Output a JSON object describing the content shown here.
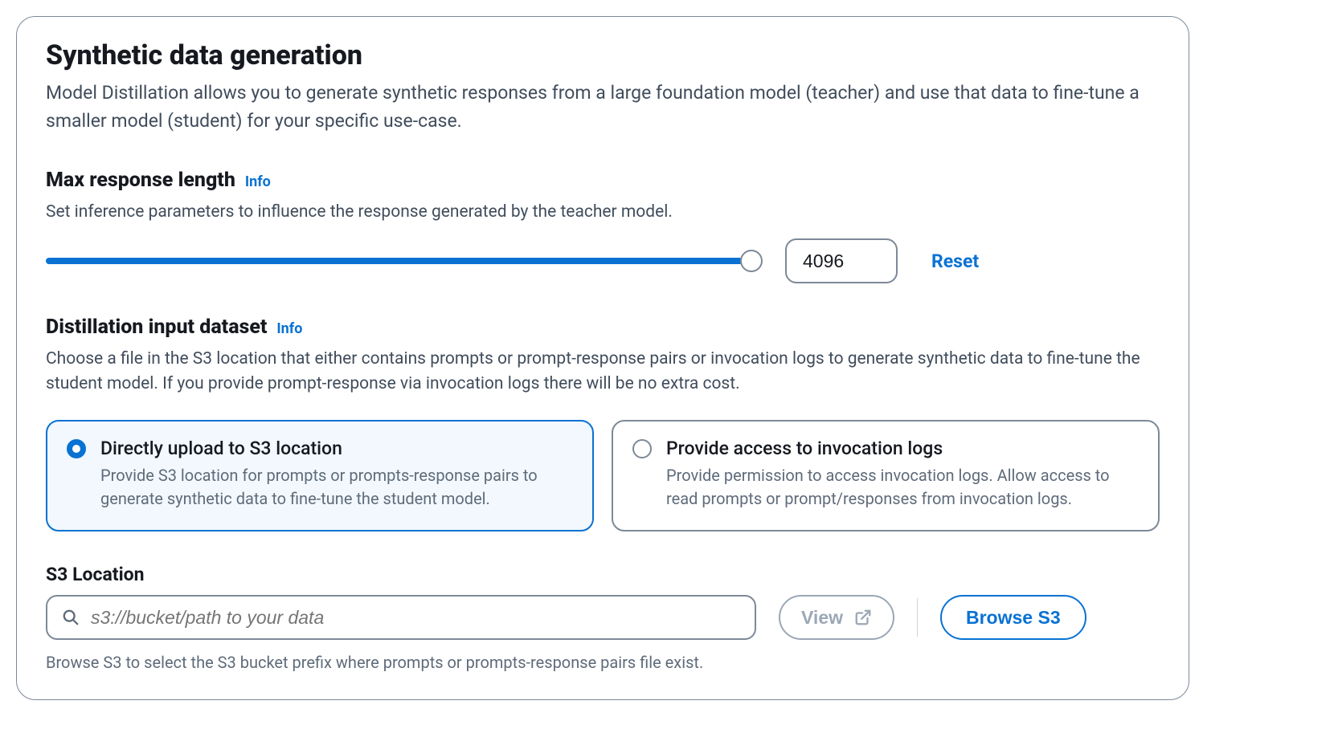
{
  "header": {
    "title": "Synthetic data generation",
    "subtitle": "Model Distillation allows you to generate synthetic responses from a large foundation model (teacher) and use that data to fine-tune a smaller model (student) for your specific use-case."
  },
  "max_response": {
    "heading": "Max response length",
    "info": "Info",
    "desc": "Set inference parameters to influence the response generated by the teacher model.",
    "value": "4096",
    "reset": "Reset"
  },
  "dataset": {
    "heading": "Distillation input dataset",
    "info": "Info",
    "desc": "Choose a file in the S3 location that either contains prompts or prompt-response pairs or invocation logs to generate synthetic data to fine-tune the student model. If you provide prompt-response via invocation logs there will be no extra cost.",
    "options": [
      {
        "title": "Directly upload to S3 location",
        "desc": "Provide S3 location for prompts or prompts-response pairs to generate synthetic data to fine-tune the student model.",
        "selected": true
      },
      {
        "title": "Provide access to invocation logs",
        "desc": "Provide permission to access invocation logs. Allow access to read prompts or prompt/responses from invocation logs.",
        "selected": false
      }
    ]
  },
  "s3": {
    "label": "S3 Location",
    "placeholder": "s3://bucket/path to your data",
    "view": "View",
    "browse": "Browse S3",
    "helper": "Browse S3 to select the S3 bucket prefix where prompts or prompts-response pairs file exist."
  }
}
